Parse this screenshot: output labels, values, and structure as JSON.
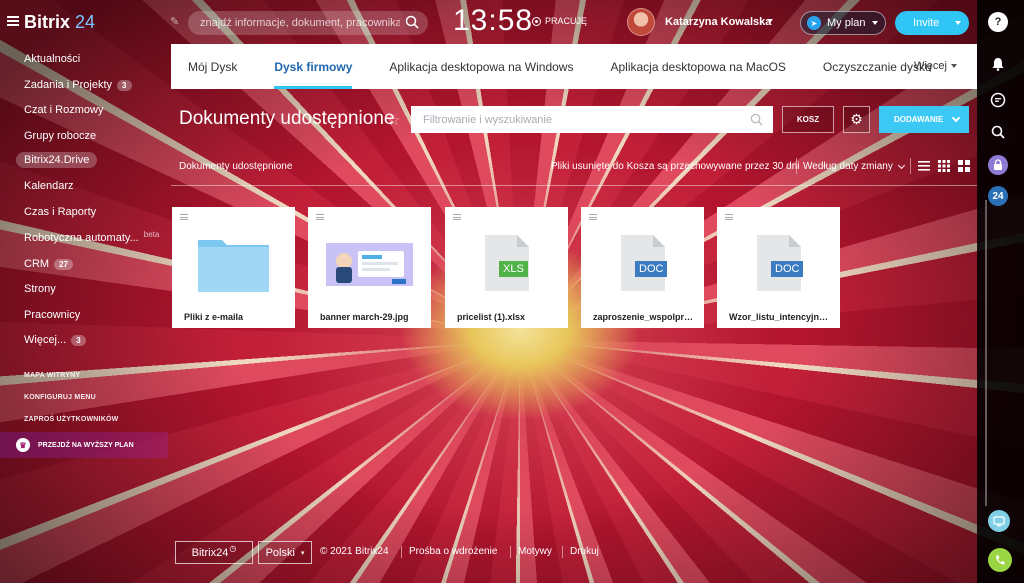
{
  "header": {
    "logo_text": "Bitrix",
    "logo_num": "24",
    "search_placeholder": "znajdź informacje, dokument, pracownika",
    "clock": "13:58",
    "status": "PRACUJĘ",
    "username": "Katarzyna Kowalska",
    "myplan": "My plan",
    "invite": "Invite"
  },
  "sidebar": {
    "items": [
      {
        "label": "Aktualności"
      },
      {
        "label": "Zadania i Projekty",
        "count": "3"
      },
      {
        "label": "Czat i Rozmowy"
      },
      {
        "label": "Grupy robocze"
      },
      {
        "label": "Bitrix24.Drive",
        "active": true
      },
      {
        "label": "Kalendarz"
      },
      {
        "label": "Czas i Raporty"
      },
      {
        "label": "Robotyczna automaty...",
        "badge": "beta"
      },
      {
        "label": "CRM",
        "count": "27"
      },
      {
        "label": "Strony"
      },
      {
        "label": "Pracownicy"
      },
      {
        "label": "Więcej...",
        "count": "3"
      }
    ],
    "links": [
      "MAPA WITRYNY",
      "KONFIGURUJ MENU",
      "ZAPROŚ UŻYTKOWNIKÓW"
    ],
    "upgrade": "PRZEJDŹ NA WYŻSZY PLAN"
  },
  "tabs": [
    {
      "label": "Mój Dysk"
    },
    {
      "label": "Dysk firmowy",
      "active": true
    },
    {
      "label": "Aplikacja desktopowa na Windows"
    },
    {
      "label": "Aplikacja desktopowa na MacOS"
    },
    {
      "label": "Oczyszczanie dysku"
    }
  ],
  "tab_more": "Więcej",
  "toolbar": {
    "title": "Dokumenty udostępnione",
    "filter_placeholder": "Filtrowanie i wyszukiwanie",
    "kosz": "KOSZ",
    "add": "DODAWANIE"
  },
  "subbar": {
    "breadcrumb": "Dokumenty udostępnione",
    "trash_note": "Pliki usunięte do Kosza są przechowywane przez 30 dni",
    "sort": "Według daty zmiany"
  },
  "files": [
    {
      "name": "Pliki z e-maila",
      "kind": "folder"
    },
    {
      "name": "banner march-29.jpg",
      "kind": "image"
    },
    {
      "name": "pricelist (1).xlsx",
      "kind": "xls",
      "label": "XLS"
    },
    {
      "name": "zaproszenie_wspolpracy.docx",
      "kind": "doc",
      "label": "DOC"
    },
    {
      "name": "Wzor_listu_intencyjnego.docx",
      "kind": "doc",
      "label": "DOC"
    }
  ],
  "footer": {
    "brand": "Bitrix24",
    "lang": "Polski",
    "copyright": "© 2021 Bitrix24",
    "links": [
      "Prośba o wdrożenie",
      "Motywy",
      "Drukuj"
    ]
  },
  "rail": {
    "badge": "24"
  },
  "colors": {
    "accent": "#2fc6f6",
    "active_tab": "#2067b0",
    "xls": "#51b347",
    "doc": "#3d7bc1"
  }
}
